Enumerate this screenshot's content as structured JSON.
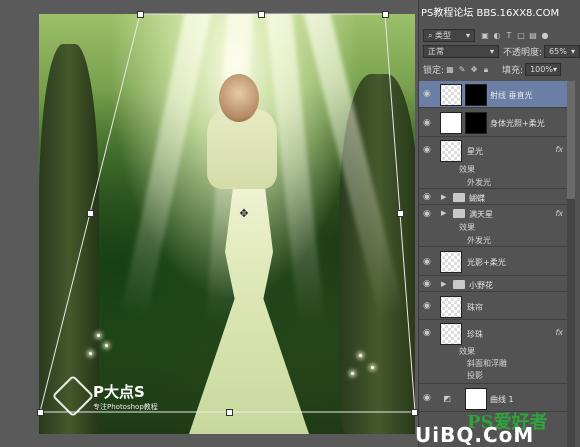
{
  "header_watermark": "PS教程论坛  BBS.16XX8.COM",
  "layers_panel": {
    "filter_kind": "类型",
    "blend_mode": "正常",
    "opacity_label": "不透明度:",
    "opacity_value": "65%",
    "lock_label": "锁定:",
    "fill_label": "填充:",
    "fill_value": "100%",
    "layers": [
      {
        "name": "射线 垂直光",
        "selected": true
      },
      {
        "name": "身体光照+柔光"
      },
      {
        "name": "星光",
        "fx": "fx",
        "effects_label": "效果",
        "effects": [
          "外发光"
        ]
      },
      {
        "name": "蝴蝶",
        "group": true
      },
      {
        "name": "满天星",
        "group": true,
        "fx": "fx",
        "effects_label": "效果",
        "effects": [
          "外发光"
        ]
      },
      {
        "name": "光影+柔光"
      },
      {
        "name": "小野花",
        "group": true
      },
      {
        "name": "珠帘"
      },
      {
        "name": "珍珠",
        "fx": "fx",
        "effects_label": "效果",
        "effects": [
          "斜面和浮雕",
          "投影"
        ]
      },
      {
        "name": "曲线 1"
      }
    ]
  },
  "canvas_watermark": {
    "title": "P大点S",
    "subtitle": "专注Photoshop教程"
  },
  "bottom_watermark": {
    "ps_text": "PS爱好者",
    "url": "UiBQ.CoM",
    "url_suffix": "·"
  }
}
